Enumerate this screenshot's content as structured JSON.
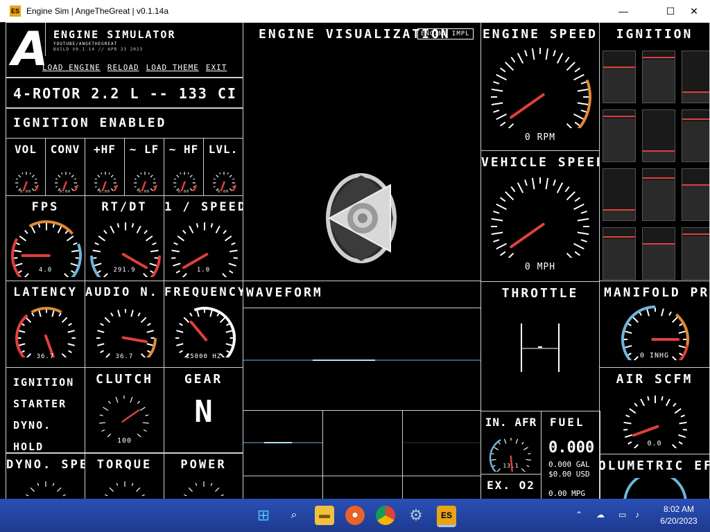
{
  "window": {
    "title": "Engine Sim | AngeTheGreat | v0.1.14a",
    "app_icon": "ES",
    "minimize": "—",
    "maximize": "☐",
    "close": "✕"
  },
  "header": {
    "logo": "A",
    "app_name": "ENGINE SIMULATOR",
    "youtube": "YOUTUBE/ANGETHEGREAT",
    "build": "BUILD V0.1.14 // APR 23 2023",
    "menu": [
      "LOAD ENGINE",
      "RELOAD",
      "LOAD THEME",
      "EXIT"
    ]
  },
  "engine_name": "4-ROTOR 2.2 L -- 133 CI",
  "ignition_status": "IGNITION ENABLED",
  "small_gauges": [
    {
      "label": "VOL",
      "value": "0.00"
    },
    {
      "label": "CONV",
      "value": "0.00"
    },
    {
      "label": "+HF",
      "value": "0.00"
    },
    {
      "label": "~ LF",
      "value": "0.00"
    },
    {
      "label": "~ HF",
      "value": "0.00"
    },
    {
      "label": "LVL.",
      "value": "0.00"
    }
  ],
  "perf": [
    {
      "label": "FPS",
      "value": "4.0"
    },
    {
      "label": "RT/DT",
      "value": "291.9"
    },
    {
      "label": "1 / SPEED",
      "value": "1.0"
    }
  ],
  "audio": [
    {
      "label": "LATENCY",
      "value": "36.7"
    },
    {
      "label": "AUDIO N. BUFFER",
      "value": "36.7"
    },
    {
      "label": "FREQUENCY",
      "value": "15000 HZ"
    }
  ],
  "controls": {
    "items": [
      "IGNITION",
      "STARTER",
      "DYNO.",
      "HOLD"
    ],
    "clutch_label": "CLUTCH",
    "clutch_value": "100",
    "gear_label": "GEAR",
    "gear_value": "N"
  },
  "bottom_left": [
    "DYNO. SPEED",
    "TORQUE",
    "POWER"
  ],
  "visualization": {
    "title": "ENGINE VISUALIZATION",
    "overlay": "ENGINE IMPL"
  },
  "waveform": {
    "title": "WAVEFORM"
  },
  "engine_speed": {
    "title": "ENGINE SPEED",
    "value": "0 RPM"
  },
  "vehicle_speed": {
    "title": "VEHICLE SPEED",
    "value": "0 MPH"
  },
  "throttle": {
    "title": "THROTTLE"
  },
  "afr": {
    "intake_label": "IN. AFR",
    "intake_value": "13.1",
    "exhaust_label": "EX. O2"
  },
  "fuel": {
    "label": "FUEL",
    "volume": "0.000 L",
    "volume_secondary": "0.000 GAL",
    "cost": "$0.00 USD",
    "mpg": "0.00 MPG"
  },
  "ignition_panel": {
    "title": "IGNITION"
  },
  "manifold": {
    "title": "MANIFOLD PRESSURE",
    "value": "0 INHG"
  },
  "air_scfm": {
    "title": "AIR SCFM",
    "value": "0.0"
  },
  "volumetric": {
    "title": "VOLUMETRIC EFF"
  },
  "taskbar": {
    "time": "8:02 AM",
    "date": "6/20/2023",
    "apps": [
      "start-icon",
      "search-icon",
      "file-explorer-icon",
      "firefox-icon",
      "chrome-icon",
      "settings-icon",
      "engine-sim-icon"
    ]
  },
  "colors": {
    "accent_red": "#e0403a",
    "accent_orange": "#e08a3a",
    "accent_blue": "#6fb6d8",
    "taskbar": "#1d3a8f"
  }
}
